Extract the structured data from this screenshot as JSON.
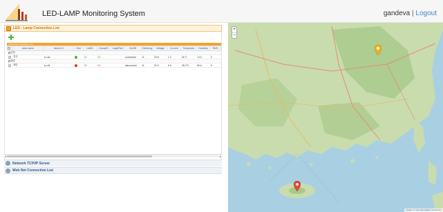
{
  "header": {
    "app_title": "LED-LAMP Monitoring System",
    "user": "gandeva",
    "separator": "|",
    "logout_label": "Logout"
  },
  "lamp_panel": {
    "title": "LED - Lamp Connection List",
    "grid_caption": "LED-Lamp Connection List",
    "columns": [
      "",
      "area name",
      "device id",
      "Hint",
      "LedID",
      "GroupID",
      "LoginFlat",
      "On/Off",
      "Dimming",
      "Voltage",
      "Current",
      "Temperatu",
      "Humidity",
      "RefD"
    ],
    "groups": [
      {
        "name": "진주",
        "rows": [
          {
            "area": "진주",
            "device_id": "1u-0a",
            "status": "on",
            "led_id": "1D",
            "group_id": "0D",
            "login": "",
            "onoff": "connected",
            "dimming": "11",
            "voltage": "23.8",
            "current": "1.2",
            "temperature": "31°C",
            "humidity": "74.0",
            "refd": "0"
          }
        ]
      },
      {
        "name": "제주",
        "rows": [
          {
            "area": "제주",
            "device_id": "1u-04",
            "status": "off",
            "led_id": "1D",
            "group_id": "0D",
            "login": "",
            "onoff": "disconnect",
            "dimming": "11",
            "voltage": "22.0",
            "current": "0.6",
            "temperature": "28.2°C",
            "humidity": "80.6",
            "refd": "0"
          }
        ]
      }
    ]
  },
  "tcp_panel": {
    "title": "Network TCP/IP Server"
  },
  "web_panel": {
    "title": "Web Net Connection List"
  },
  "map": {
    "zoom_in": "+",
    "zoom_out": "−",
    "attribution": "Leaflet | © OpenStreetMap contributors",
    "markers": [
      {
        "name": "진주",
        "status": "on",
        "color": "#f2b21b"
      },
      {
        "name": "제주",
        "status": "off",
        "color": "#e24a3b"
      }
    ]
  },
  "colors": {
    "accent": "#f4a22b",
    "link": "#3a86c8",
    "on": "#3bb33b",
    "off": "#e23434"
  }
}
